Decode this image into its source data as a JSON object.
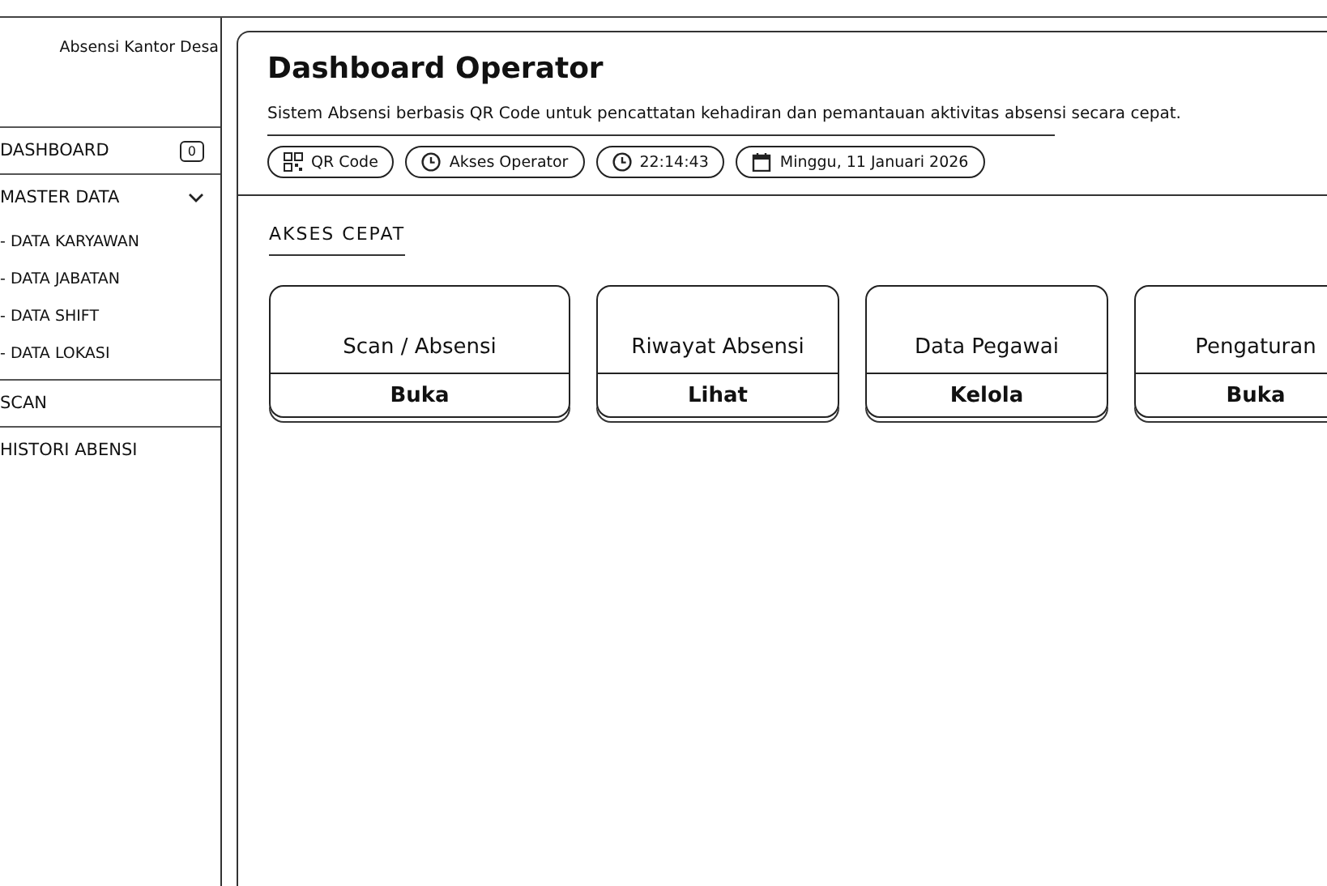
{
  "sidebar": {
    "brand": "Absensi Kantor Desa",
    "items": [
      {
        "label": "DASHBOARD",
        "badge": "0"
      },
      {
        "label": "MASTER DATA",
        "expanded": true,
        "children": [
          {
            "label": "- DATA KARYAWAN"
          },
          {
            "label": "- DATA JABATAN"
          },
          {
            "label": "- DATA SHIFT"
          },
          {
            "label": "- DATA LOKASI"
          }
        ]
      },
      {
        "label": "SCAN"
      },
      {
        "label": "HISTORI ABENSI"
      }
    ]
  },
  "header": {
    "title": "Dashboard Operator",
    "subtitle": "Sistem Absensi berbasis QR Code untuk pencattatan kehadiran dan pemantauan aktivitas absensi secara cepat.",
    "pills": [
      {
        "kind": "qr",
        "label": "QR Code"
      },
      {
        "kind": "clock",
        "label": "Akses Operator"
      },
      {
        "kind": "clock",
        "label": "22:14:43"
      },
      {
        "kind": "calendar",
        "label": "Minggu, 11 Januari 2026"
      }
    ]
  },
  "quick_access": {
    "title": "AKSES CEPAT",
    "cards": [
      {
        "title": "Scan / Absensi",
        "action": "Buka"
      },
      {
        "title": "Riwayat Absensi",
        "action": "Lihat"
      },
      {
        "title": "Data Pegawai",
        "action": "Kelola"
      },
      {
        "title": "Pengaturan",
        "action": "Buka"
      }
    ]
  }
}
